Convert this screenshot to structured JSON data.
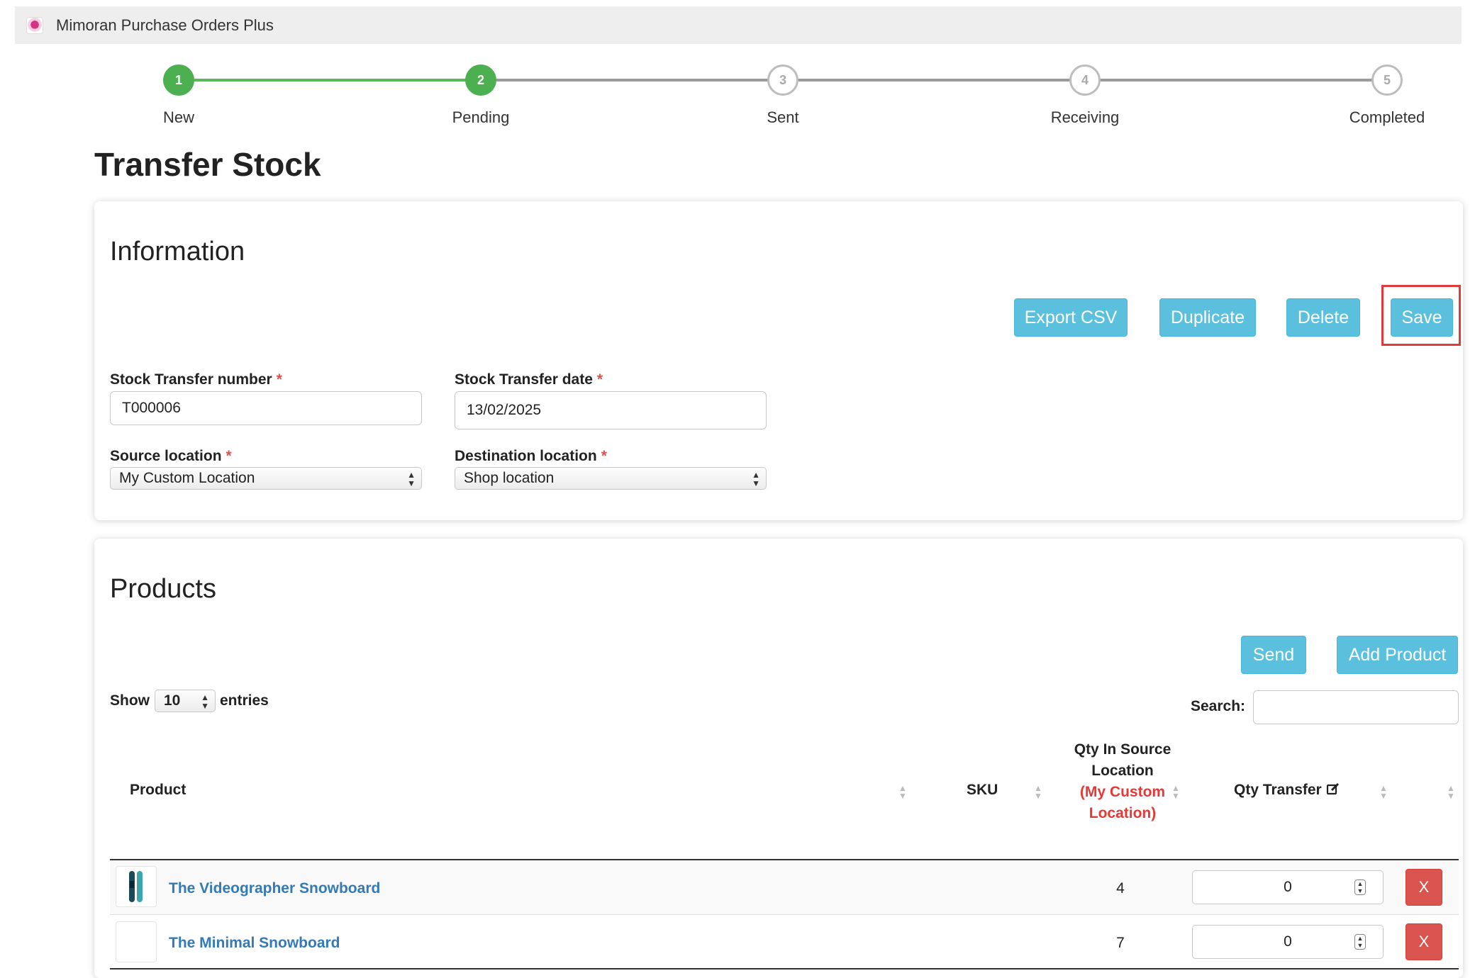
{
  "app": {
    "title": "Mimoran Purchase Orders Plus"
  },
  "steps": [
    {
      "number": "1",
      "label": "New"
    },
    {
      "number": "2",
      "label": "Pending"
    },
    {
      "number": "3",
      "label": "Sent"
    },
    {
      "number": "4",
      "label": "Receiving"
    },
    {
      "number": "5",
      "label": "Completed"
    }
  ],
  "page": {
    "title": "Transfer Stock"
  },
  "information": {
    "title": "Information",
    "buttons": {
      "export": "Export CSV",
      "duplicate": "Duplicate",
      "delete": "Delete",
      "save": "Save"
    },
    "fields": {
      "number_label": "Stock Transfer number",
      "number_value": "T000006",
      "date_label": "Stock Transfer date",
      "date_value": "13/02/2025",
      "source_label": "Source location",
      "source_value": "My Custom Location",
      "destination_label": "Destination location",
      "destination_value": "Shop location",
      "required_mark": "*"
    }
  },
  "products": {
    "title": "Products",
    "buttons": {
      "send": "Send",
      "add": "Add Product"
    },
    "show_label": "Show",
    "entries_value": "10",
    "entries_label": "entries",
    "search_label": "Search:",
    "columns": {
      "product": "Product",
      "sku": "SKU",
      "qty_source": "Qty In Source Location",
      "qty_source_note": "(My Custom Location)",
      "qty_transfer": "Qty Transfer"
    },
    "rows": [
      {
        "name": "The Videographer Snowboard",
        "sku": "",
        "qty_source": "4",
        "qty_transfer": "0",
        "remove": "X"
      },
      {
        "name": "The Minimal Snowboard",
        "sku": "",
        "qty_source": "7",
        "qty_transfer": "0",
        "remove": "X"
      }
    ]
  },
  "colors": {
    "accent": "#5bc0de",
    "step_done": "#4caf50",
    "danger": "#d9534f",
    "link": "#337ab7"
  }
}
